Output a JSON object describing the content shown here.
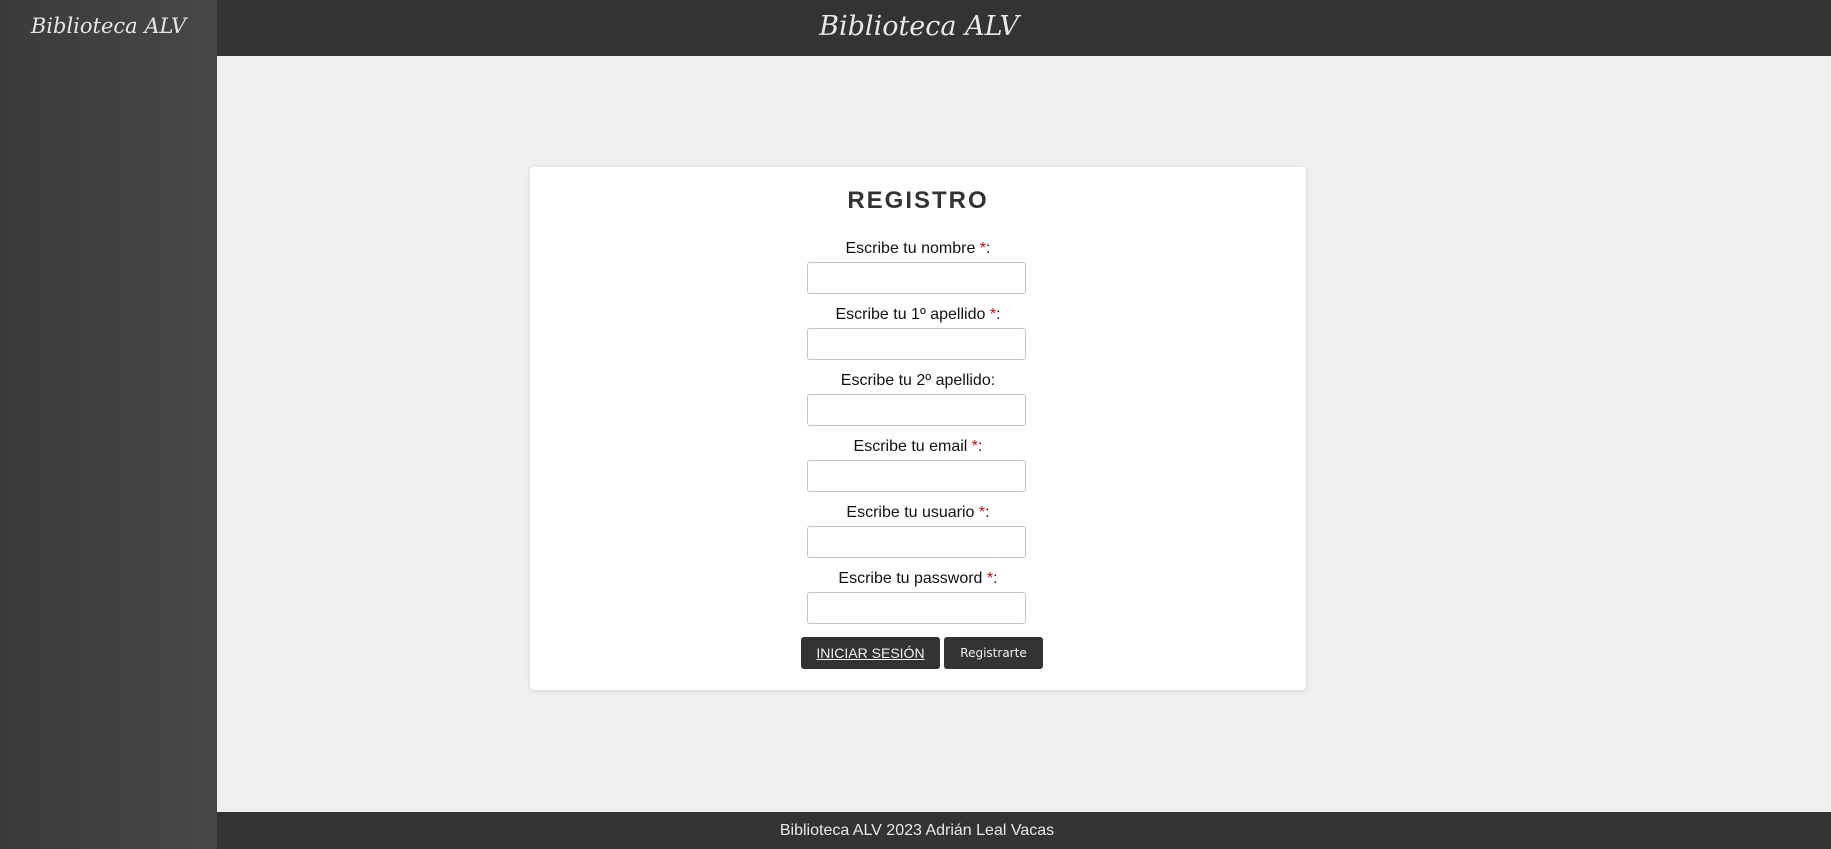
{
  "sidebar": {
    "logo_text": "Biblioteca ALV"
  },
  "header": {
    "title": "Biblioteca ALV"
  },
  "form": {
    "title": "REGISTRO",
    "required_marker": "*",
    "fields": [
      {
        "label": "Escribe tu nombre",
        "required": true,
        "value": ""
      },
      {
        "label": "Escribe tu 1º apellido",
        "required": true,
        "value": ""
      },
      {
        "label": "Escribe tu 2º apellido",
        "required": false,
        "value": ""
      },
      {
        "label": "Escribe tu email",
        "required": true,
        "value": ""
      },
      {
        "label": "Escribe tu usuario",
        "required": true,
        "value": ""
      },
      {
        "label": "Escribe tu password",
        "required": true,
        "value": ""
      }
    ],
    "login_button": "INICIAR SESIÓN",
    "register_button": "Registrarte"
  },
  "footer": {
    "text": "Biblioteca ALV 2023 Adrián Leal Vacas"
  },
  "colors": {
    "sidebar_bg": "#3f3f3f",
    "header_bg": "#333333",
    "page_bg": "#efefef",
    "card_bg": "#ffffff",
    "required_marker": "#e00000",
    "button_bg": "#333333"
  }
}
